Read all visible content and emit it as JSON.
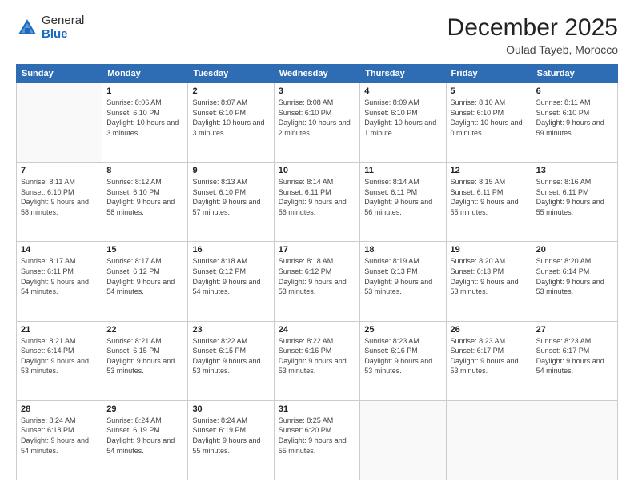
{
  "logo": {
    "general": "General",
    "blue": "Blue"
  },
  "header": {
    "month": "December 2025",
    "location": "Oulad Tayeb, Morocco"
  },
  "days_of_week": [
    "Sunday",
    "Monday",
    "Tuesday",
    "Wednesday",
    "Thursday",
    "Friday",
    "Saturday"
  ],
  "weeks": [
    [
      {
        "day": "",
        "info": ""
      },
      {
        "day": "1",
        "info": "Sunrise: 8:06 AM\nSunset: 6:10 PM\nDaylight: 10 hours\nand 3 minutes."
      },
      {
        "day": "2",
        "info": "Sunrise: 8:07 AM\nSunset: 6:10 PM\nDaylight: 10 hours\nand 3 minutes."
      },
      {
        "day": "3",
        "info": "Sunrise: 8:08 AM\nSunset: 6:10 PM\nDaylight: 10 hours\nand 2 minutes."
      },
      {
        "day": "4",
        "info": "Sunrise: 8:09 AM\nSunset: 6:10 PM\nDaylight: 10 hours\nand 1 minute."
      },
      {
        "day": "5",
        "info": "Sunrise: 8:10 AM\nSunset: 6:10 PM\nDaylight: 10 hours\nand 0 minutes."
      },
      {
        "day": "6",
        "info": "Sunrise: 8:11 AM\nSunset: 6:10 PM\nDaylight: 9 hours\nand 59 minutes."
      }
    ],
    [
      {
        "day": "7",
        "info": "Sunrise: 8:11 AM\nSunset: 6:10 PM\nDaylight: 9 hours\nand 58 minutes."
      },
      {
        "day": "8",
        "info": "Sunrise: 8:12 AM\nSunset: 6:10 PM\nDaylight: 9 hours\nand 58 minutes."
      },
      {
        "day": "9",
        "info": "Sunrise: 8:13 AM\nSunset: 6:10 PM\nDaylight: 9 hours\nand 57 minutes."
      },
      {
        "day": "10",
        "info": "Sunrise: 8:14 AM\nSunset: 6:11 PM\nDaylight: 9 hours\nand 56 minutes."
      },
      {
        "day": "11",
        "info": "Sunrise: 8:14 AM\nSunset: 6:11 PM\nDaylight: 9 hours\nand 56 minutes."
      },
      {
        "day": "12",
        "info": "Sunrise: 8:15 AM\nSunset: 6:11 PM\nDaylight: 9 hours\nand 55 minutes."
      },
      {
        "day": "13",
        "info": "Sunrise: 8:16 AM\nSunset: 6:11 PM\nDaylight: 9 hours\nand 55 minutes."
      }
    ],
    [
      {
        "day": "14",
        "info": "Sunrise: 8:17 AM\nSunset: 6:11 PM\nDaylight: 9 hours\nand 54 minutes."
      },
      {
        "day": "15",
        "info": "Sunrise: 8:17 AM\nSunset: 6:12 PM\nDaylight: 9 hours\nand 54 minutes."
      },
      {
        "day": "16",
        "info": "Sunrise: 8:18 AM\nSunset: 6:12 PM\nDaylight: 9 hours\nand 54 minutes."
      },
      {
        "day": "17",
        "info": "Sunrise: 8:18 AM\nSunset: 6:12 PM\nDaylight: 9 hours\nand 53 minutes."
      },
      {
        "day": "18",
        "info": "Sunrise: 8:19 AM\nSunset: 6:13 PM\nDaylight: 9 hours\nand 53 minutes."
      },
      {
        "day": "19",
        "info": "Sunrise: 8:20 AM\nSunset: 6:13 PM\nDaylight: 9 hours\nand 53 minutes."
      },
      {
        "day": "20",
        "info": "Sunrise: 8:20 AM\nSunset: 6:14 PM\nDaylight: 9 hours\nand 53 minutes."
      }
    ],
    [
      {
        "day": "21",
        "info": "Sunrise: 8:21 AM\nSunset: 6:14 PM\nDaylight: 9 hours\nand 53 minutes."
      },
      {
        "day": "22",
        "info": "Sunrise: 8:21 AM\nSunset: 6:15 PM\nDaylight: 9 hours\nand 53 minutes."
      },
      {
        "day": "23",
        "info": "Sunrise: 8:22 AM\nSunset: 6:15 PM\nDaylight: 9 hours\nand 53 minutes."
      },
      {
        "day": "24",
        "info": "Sunrise: 8:22 AM\nSunset: 6:16 PM\nDaylight: 9 hours\nand 53 minutes."
      },
      {
        "day": "25",
        "info": "Sunrise: 8:23 AM\nSunset: 6:16 PM\nDaylight: 9 hours\nand 53 minutes."
      },
      {
        "day": "26",
        "info": "Sunrise: 8:23 AM\nSunset: 6:17 PM\nDaylight: 9 hours\nand 53 minutes."
      },
      {
        "day": "27",
        "info": "Sunrise: 8:23 AM\nSunset: 6:17 PM\nDaylight: 9 hours\nand 54 minutes."
      }
    ],
    [
      {
        "day": "28",
        "info": "Sunrise: 8:24 AM\nSunset: 6:18 PM\nDaylight: 9 hours\nand 54 minutes."
      },
      {
        "day": "29",
        "info": "Sunrise: 8:24 AM\nSunset: 6:19 PM\nDaylight: 9 hours\nand 54 minutes."
      },
      {
        "day": "30",
        "info": "Sunrise: 8:24 AM\nSunset: 6:19 PM\nDaylight: 9 hours\nand 55 minutes."
      },
      {
        "day": "31",
        "info": "Sunrise: 8:25 AM\nSunset: 6:20 PM\nDaylight: 9 hours\nand 55 minutes."
      },
      {
        "day": "",
        "info": ""
      },
      {
        "day": "",
        "info": ""
      },
      {
        "day": "",
        "info": ""
      }
    ]
  ]
}
